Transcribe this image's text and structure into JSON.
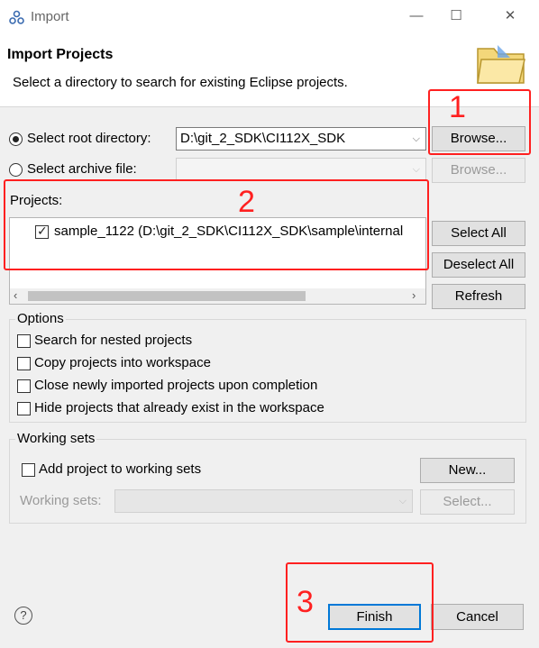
{
  "window": {
    "title": "Import"
  },
  "header": {
    "title": "Import Projects",
    "description": "Select a directory to search for existing Eclipse projects."
  },
  "source": {
    "root_label": "Select root directory:",
    "root_value": "D:\\git_2_SDK\\CI112X_SDK",
    "root_browse": "Browse...",
    "archive_label": "Select archive file:",
    "archive_browse": "Browse..."
  },
  "projects": {
    "label": "Projects:",
    "items": [
      {
        "label": "sample_1122 (D:\\git_2_SDK\\CI112X_SDK\\sample\\internal"
      }
    ],
    "select_all": "Select All",
    "deselect_all": "Deselect All",
    "refresh": "Refresh"
  },
  "options": {
    "title": "Options",
    "items": [
      "Search for nested projects",
      "Copy projects into workspace",
      "Close newly imported projects upon completion",
      "Hide projects that already exist in the workspace"
    ]
  },
  "working_sets": {
    "title": "Working sets",
    "add_label": "Add project to working sets",
    "new_button": "New...",
    "sets_label": "Working sets:",
    "select_button": "Select..."
  },
  "footer": {
    "help": "?",
    "finish": "Finish",
    "cancel": "Cancel"
  },
  "annotations": [
    "1",
    "2",
    "3"
  ],
  "colors": {
    "annotation": "#ff2020",
    "default_button_border": "#0078d7"
  }
}
